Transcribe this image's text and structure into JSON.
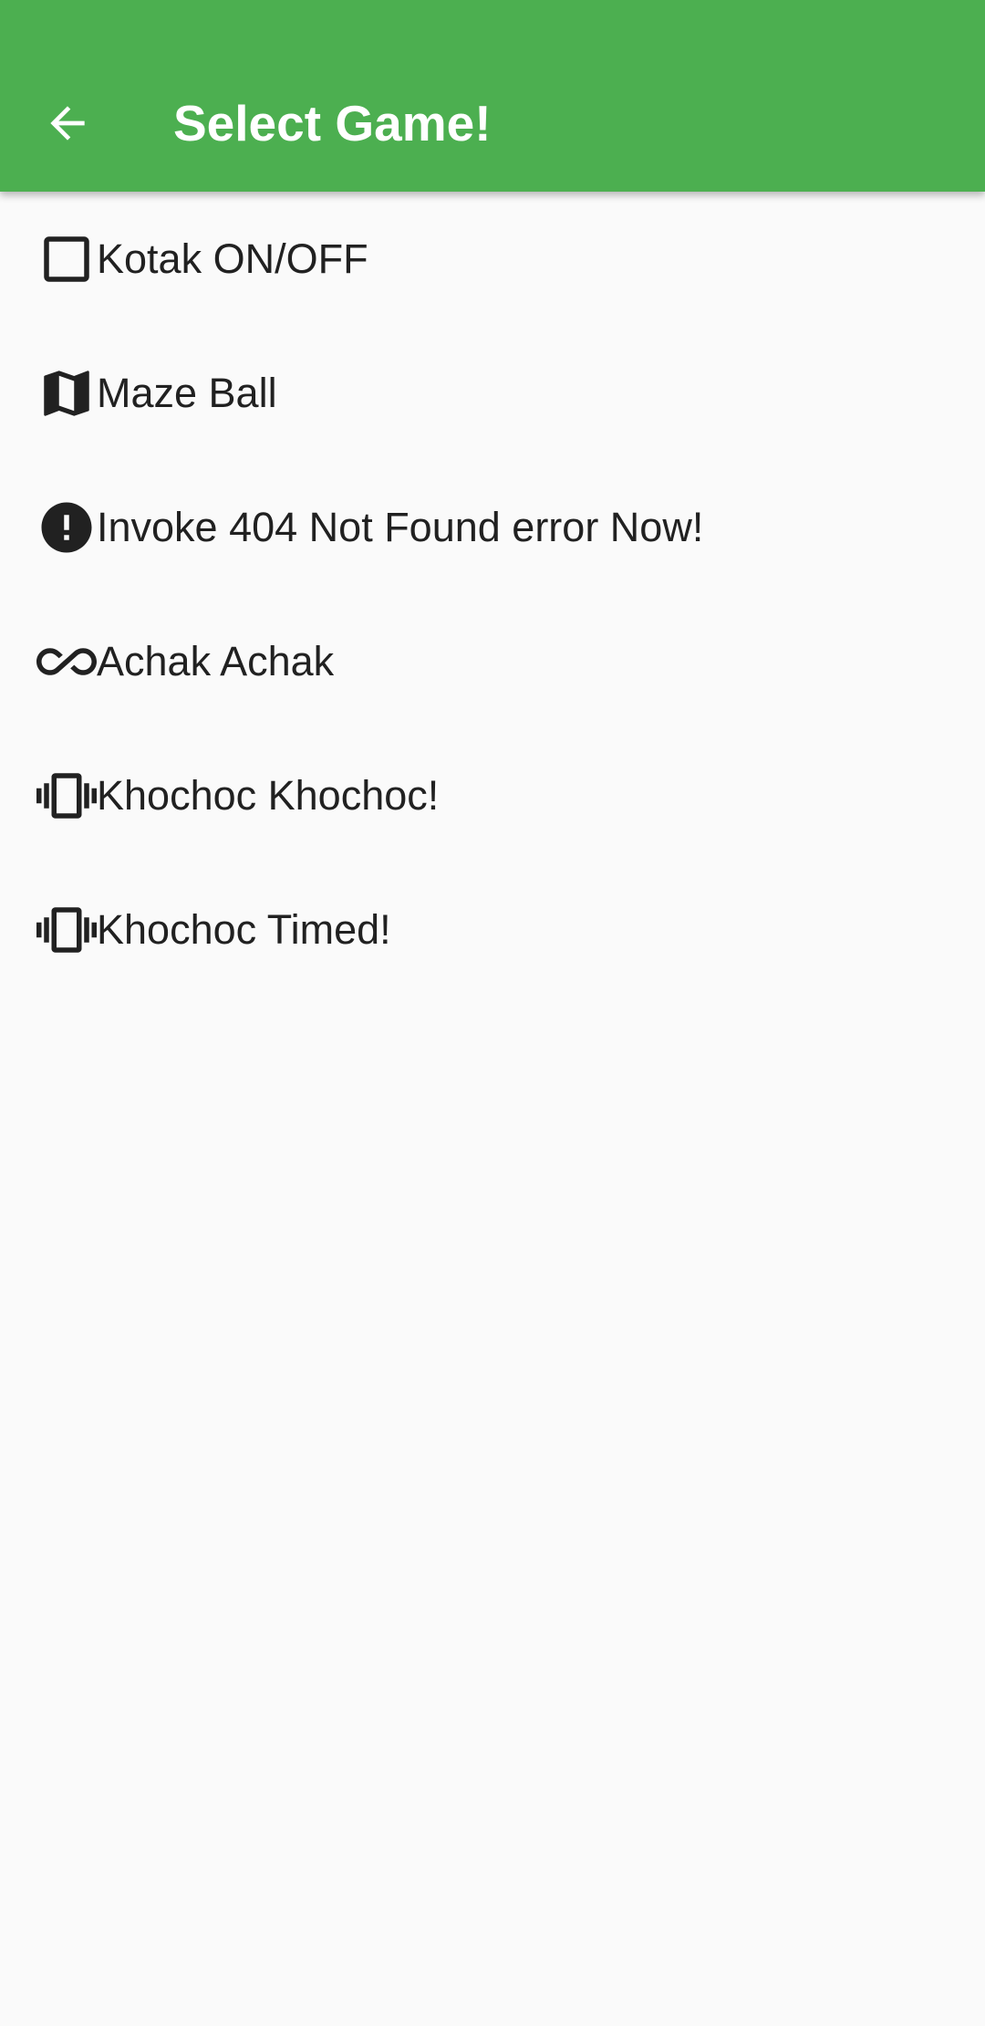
{
  "app_bar": {
    "title": "Select Game!",
    "back_icon": "arrow-back-icon",
    "color": "#4caf50"
  },
  "games": [
    {
      "label": "Kotak ON/OFF",
      "icon": "square-outline-icon"
    },
    {
      "label": "Maze Ball",
      "icon": "map-icon"
    },
    {
      "label": "Invoke 404 Not Found error Now!",
      "icon": "error-icon"
    },
    {
      "label": "Achak Achak",
      "icon": "infinity-icon"
    },
    {
      "label": "Khochoc Khochoc!",
      "icon": "vibration-icon"
    },
    {
      "label": "Khochoc Timed!",
      "icon": "vibration-icon"
    }
  ]
}
